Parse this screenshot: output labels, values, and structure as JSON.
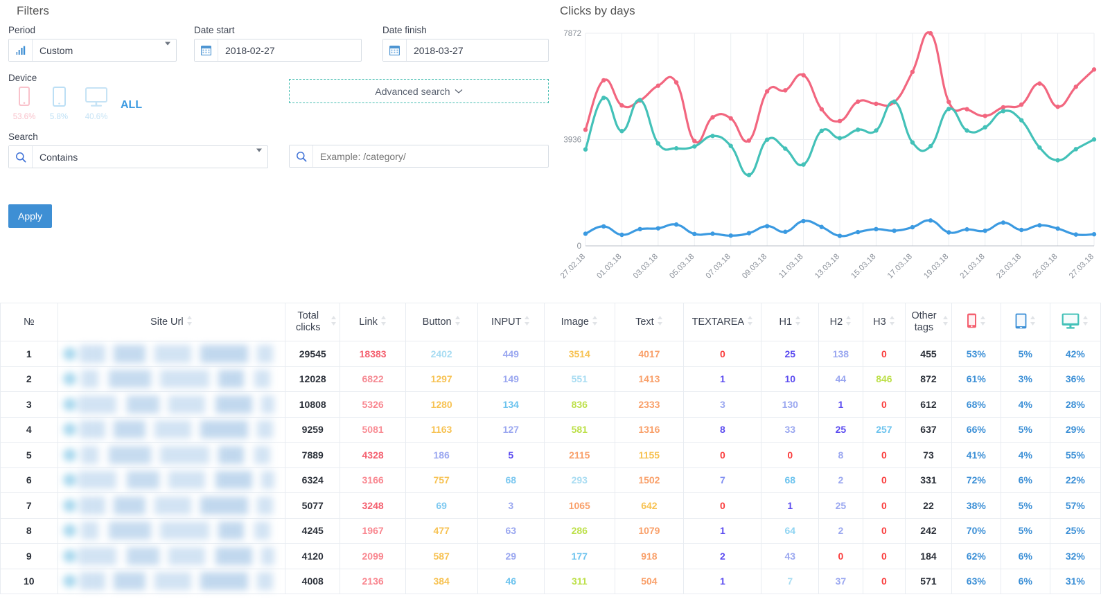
{
  "filters": {
    "title": "Filters",
    "period": {
      "label": "Period",
      "value": "Custom",
      "icon": "bar-chart-icon"
    },
    "date_start": {
      "label": "Date start",
      "value": "2018-02-27",
      "icon": "calendar-icon"
    },
    "date_finish": {
      "label": "Date finish",
      "value": "2018-03-27",
      "icon": "calendar-icon"
    },
    "device": {
      "label": "Device",
      "items": [
        {
          "name": "mobile",
          "pct": "53.6%",
          "color": "#f9c2cb"
        },
        {
          "name": "tablet",
          "pct": "5.8%",
          "color": "#bcdff5"
        },
        {
          "name": "desktop",
          "pct": "40.6%",
          "color": "#c6e3f5"
        }
      ],
      "all_label": "ALL"
    },
    "advanced_search": {
      "label": "Advanced search",
      "chevron": "chevron-down-icon"
    },
    "search": {
      "label": "Search",
      "mode_value": "Contains",
      "query_value": "",
      "query_placeholder": "Example: /category/"
    },
    "apply_label": "Apply"
  },
  "chart_data": {
    "type": "line",
    "title": "Clicks by days",
    "xlabel": "",
    "ylabel": "",
    "ylim": [
      0,
      7872
    ],
    "yticks": [
      0,
      3936,
      7872
    ],
    "ytick_labels": [
      "0",
      "3936",
      "7872"
    ],
    "grid": true,
    "legend_position": "none",
    "x": [
      "27.02.18",
      "28.02.18",
      "01.03.18",
      "02.03.18",
      "03.03.18",
      "04.03.18",
      "05.03.18",
      "06.03.18",
      "07.03.18",
      "08.03.18",
      "09.03.18",
      "10.03.18",
      "11.03.18",
      "12.03.18",
      "13.03.18",
      "14.03.18",
      "15.03.18",
      "16.03.18",
      "17.03.18",
      "18.03.18",
      "19.03.18",
      "20.03.18",
      "21.03.18",
      "22.03.18",
      "23.03.18",
      "24.03.18",
      "25.03.18",
      "26.03.18",
      "27.03.18"
    ],
    "xtick_labels": [
      "27.02.18",
      "01.03.18",
      "03.03.18",
      "05.03.18",
      "07.03.18",
      "09.03.18",
      "11.03.18",
      "13.03.18",
      "15.03.18",
      "17.03.18",
      "19.03.18",
      "21.03.18",
      "23.03.18",
      "25.03.18",
      "27.03.18"
    ],
    "series": [
      {
        "name": "mobile",
        "color": "#f2667f",
        "values": [
          4300,
          6130,
          5200,
          5380,
          5930,
          6050,
          3880,
          4760,
          4720,
          3900,
          5720,
          5760,
          6320,
          5060,
          4620,
          5340,
          5260,
          5320,
          6440,
          7870,
          5330,
          5060,
          4810,
          5130,
          5230,
          6010,
          5150,
          5890,
          6530
        ]
      },
      {
        "name": "desktop",
        "color": "#43c1b8",
        "values": [
          3570,
          5480,
          4250,
          5400,
          3790,
          3610,
          3680,
          4070,
          3700,
          2620,
          3930,
          3600,
          3010,
          4260,
          3990,
          4300,
          4270,
          5340,
          3830,
          3690,
          5070,
          4270,
          4390,
          4990,
          4650,
          3640,
          3170,
          3580,
          3940
        ]
      },
      {
        "name": "tablet",
        "color": "#3b9ae1",
        "values": [
          450,
          720,
          410,
          620,
          650,
          790,
          440,
          450,
          380,
          470,
          730,
          520,
          920,
          700,
          370,
          510,
          620,
          560,
          690,
          940,
          500,
          610,
          560,
          860,
          590,
          760,
          640,
          420,
          430
        ]
      }
    ]
  },
  "table": {
    "columns": [
      {
        "key": "idx",
        "label": "№",
        "sortable": false
      },
      {
        "key": "url",
        "label": "Site Url",
        "sortable": true
      },
      {
        "key": "total",
        "label": "Total clicks",
        "sortable": true
      },
      {
        "key": "link",
        "label": "Link",
        "sortable": true
      },
      {
        "key": "button",
        "label": "Button",
        "sortable": true
      },
      {
        "key": "input",
        "label": "INPUT",
        "sortable": true
      },
      {
        "key": "image",
        "label": "Image",
        "sortable": true
      },
      {
        "key": "text",
        "label": "Text",
        "sortable": true
      },
      {
        "key": "textarea",
        "label": "TEXTAREA",
        "sortable": true
      },
      {
        "key": "h1",
        "label": "H1",
        "sortable": true
      },
      {
        "key": "h2",
        "label": "H2",
        "sortable": true
      },
      {
        "key": "h3",
        "label": "H3",
        "sortable": true
      },
      {
        "key": "other",
        "label": "Other tags",
        "sortable": true
      },
      {
        "key": "mobile",
        "label": "",
        "icon": "mobile-icon",
        "sortable": true
      },
      {
        "key": "tablet",
        "label": "",
        "icon": "tablet-icon",
        "sortable": true
      },
      {
        "key": "desktop",
        "label": "",
        "icon": "desktop-icon",
        "sortable": true
      }
    ],
    "rows": [
      {
        "idx": "1",
        "url": "",
        "total": "29545",
        "link": "18383",
        "button": "2402",
        "input": "449",
        "image": "3514",
        "text": "4017",
        "textarea": "0",
        "h1": "25",
        "h2": "138",
        "h3": "0",
        "other": "455",
        "mobile": "53%",
        "tablet": "5%",
        "desktop": "42%"
      },
      {
        "idx": "2",
        "url": "",
        "total": "12028",
        "link": "6822",
        "button": "1297",
        "input": "149",
        "image": "551",
        "text": "1413",
        "textarea": "1",
        "h1": "10",
        "h2": "44",
        "h3": "846",
        "other": "872",
        "mobile": "61%",
        "tablet": "3%",
        "desktop": "36%"
      },
      {
        "idx": "3",
        "url": "",
        "total": "10808",
        "link": "5326",
        "button": "1280",
        "input": "134",
        "image": "836",
        "text": "2333",
        "textarea": "3",
        "h1": "130",
        "h2": "1",
        "h3": "0",
        "other": "612",
        "mobile": "68%",
        "tablet": "4%",
        "desktop": "28%"
      },
      {
        "idx": "4",
        "url": "",
        "total": "9259",
        "link": "5081",
        "button": "1163",
        "input": "127",
        "image": "581",
        "text": "1316",
        "textarea": "8",
        "h1": "33",
        "h2": "25",
        "h3": "257",
        "other": "637",
        "mobile": "66%",
        "tablet": "5%",
        "desktop": "29%"
      },
      {
        "idx": "5",
        "url": "",
        "total": "7889",
        "link": "4328",
        "button": "186",
        "input": "5",
        "image": "2115",
        "text": "1155",
        "textarea": "0",
        "h1": "0",
        "h2": "8",
        "h3": "0",
        "other": "73",
        "mobile": "41%",
        "tablet": "4%",
        "desktop": "55%"
      },
      {
        "idx": "6",
        "url": "",
        "total": "6324",
        "link": "3166",
        "button": "757",
        "input": "68",
        "image": "293",
        "text": "1502",
        "textarea": "7",
        "h1": "68",
        "h2": "2",
        "h3": "0",
        "other": "331",
        "mobile": "72%",
        "tablet": "6%",
        "desktop": "22%"
      },
      {
        "idx": "7",
        "url": "",
        "total": "5077",
        "link": "3248",
        "button": "69",
        "input": "3",
        "image": "1065",
        "text": "642",
        "textarea": "0",
        "h1": "1",
        "h2": "25",
        "h3": "0",
        "other": "22",
        "mobile": "38%",
        "tablet": "5%",
        "desktop": "57%"
      },
      {
        "idx": "8",
        "url": "",
        "total": "4245",
        "link": "1967",
        "button": "477",
        "input": "63",
        "image": "286",
        "text": "1079",
        "textarea": "1",
        "h1": "64",
        "h2": "2",
        "h3": "0",
        "other": "242",
        "mobile": "70%",
        "tablet": "5%",
        "desktop": "25%"
      },
      {
        "idx": "9",
        "url": "",
        "total": "4120",
        "link": "2099",
        "button": "587",
        "input": "29",
        "image": "177",
        "text": "918",
        "textarea": "2",
        "h1": "43",
        "h2": "0",
        "h3": "0",
        "other": "184",
        "mobile": "62%",
        "tablet": "6%",
        "desktop": "32%"
      },
      {
        "idx": "10",
        "url": "",
        "total": "4008",
        "link": "2136",
        "button": "384",
        "input": "46",
        "image": "311",
        "text": "504",
        "textarea": "1",
        "h1": "7",
        "h2": "37",
        "h3": "0",
        "other": "571",
        "mobile": "63%",
        "tablet": "6%",
        "desktop": "31%"
      }
    ],
    "cell_colors": {
      "link": [
        "#f4606f",
        "#f58a93",
        "#f9868f",
        "#f98c94",
        "#f4606f",
        "#f9868f",
        "#f4606f",
        "#f9868f",
        "#f9868f",
        "#f9868f"
      ],
      "button": [
        "#a8dcf2",
        "#f7c252",
        "#f7c252",
        "#f7c252",
        "#9aa7f0",
        "#f7c252",
        "#7cc8f0",
        "#f7c252",
        "#f7c252",
        "#f7c252"
      ],
      "input": [
        "#9aa7f0",
        "#9aa7f0",
        "#6cc3ee",
        "#9aa7f0",
        "#5b4bf0",
        "#7cc8f0",
        "#9aa7f0",
        "#9aa7f0",
        "#9aa7f0",
        "#6cc3ee"
      ],
      "image": [
        "#f7c252",
        "#a8dcf2",
        "#bde04a",
        "#bde04a",
        "#f9a06a",
        "#a8dcf2",
        "#f9a06a",
        "#bde04a",
        "#6cc3ee",
        "#bde04a"
      ],
      "text": [
        "#f9a06a",
        "#f9a06a",
        "#f9a06a",
        "#f9a06a",
        "#f7c252",
        "#f9a06a",
        "#f7c252",
        "#f9a06a",
        "#f9a06a",
        "#f9a06a"
      ],
      "textarea": [
        "#fa3c3c",
        "#5b4bf0",
        "#9aa7f0",
        "#5b4bf0",
        "#fa3c3c",
        "#7f8ef2",
        "#fa3c3c",
        "#5b4bf0",
        "#5b4bf0",
        "#5b4bf0"
      ],
      "h1": [
        "#5b4bf0",
        "#5b4bf0",
        "#9aa7f0",
        "#9aa7f0",
        "#fa3c3c",
        "#6cc3ee",
        "#5b4bf0",
        "#8fd4f2",
        "#9aa7f0",
        "#a8dcf2"
      ],
      "h2": [
        "#9aa7f0",
        "#9aa7f0",
        "#5b4bf0",
        "#5b4bf0",
        "#9aa7f0",
        "#9aa7f0",
        "#9aa7f0",
        "#9aa7f0",
        "#fa3c3c",
        "#9aa7f0"
      ],
      "h3": [
        "#fa3c3c",
        "#bde04a",
        "#fa3c3c",
        "#6cc3ee",
        "#fa3c3c",
        "#fa3c3c",
        "#fa3c3c",
        "#fa3c3c",
        "#fa3c3c",
        "#fa3c3c"
      ],
      "device": "#3b8fd6"
    }
  }
}
